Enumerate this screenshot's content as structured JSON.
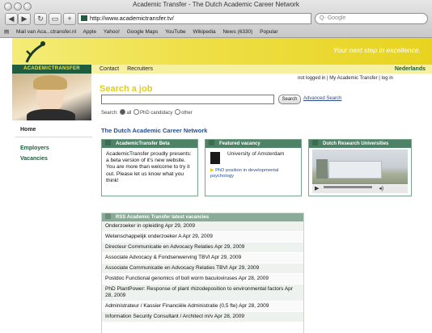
{
  "window": {
    "title": "Academic Transfer - The Dutch Academic Career Network"
  },
  "toolbar": {
    "back_icon": "back-icon",
    "forward_icon": "forward-icon",
    "reload_icon": "reload-icon",
    "add_icon": "plus-icon",
    "url": "http://www.academictransfer.tv/",
    "search_placeholder": "Q- Google"
  },
  "bookmarks": [
    "Mail van Aca...ctransfer.nl",
    "Apple",
    "Yahoo!",
    "Google Maps",
    "YouTube",
    "Wikipedia",
    "News (6330)",
    "Popular"
  ],
  "site": {
    "tagline": "Your next step in excellence.",
    "logo_text": "ACADEMICTRANSFER",
    "nav": {
      "contact": "Contact",
      "recruiters": "Recruiters",
      "language": "Nederlands"
    },
    "login": {
      "status": "not logged in",
      "my": "My Academic Transfer",
      "login": "log in"
    },
    "search": {
      "title": "Search a job",
      "button": "Search",
      "advanced": "Advanced Search",
      "filter_label": "Search:",
      "opt_all": "all",
      "opt_phd": "PhD candidacy",
      "opt_other": "other"
    },
    "sidebar": {
      "home": "Home",
      "employers": "Employers",
      "vacancies": "Vacancies"
    },
    "main_title": "The Dutch Academic Career Network",
    "beta": {
      "header": "AcademicTransfer Beta",
      "body": "AcademicTransfer proudly presents: a beta version of it's new website. You are more than welcome to try it out. Please let us know what you think!"
    },
    "featured": {
      "header": "Featured vacancy",
      "university": "University of Amsterdam",
      "link": "PhD position in developmental psychology"
    },
    "dutch": {
      "header": "Dutch Research Universities"
    },
    "rss": {
      "header": "RSS Academic Transfer latest vacancies",
      "items": [
        "Onderzoeker in opleiding Apr 29, 2009",
        "Wetenschappelijk onderzoeker A Apr 29, 2009",
        "Directeur Communicatie en Advocacy Relaties Apr 29, 2009",
        "Associate Advocacy & Fondsenwerving TBVI Apr 29, 2009",
        "Associate Communicatie en Advocacy Relaties TBVI Apr 29, 2009",
        "Postdoc Functional genomics of boll worm baculoviruses Apr 28, 2009",
        "PhD PlantPower: Response of plant rhizodeposition to environmental factors Apr 28, 2009",
        "Administrateur / Kassier Financiële Administratie (0,5 fte) Apr 28, 2009",
        "Information Security Consultant / Architect m/v Apr 28, 2009"
      ]
    }
  }
}
